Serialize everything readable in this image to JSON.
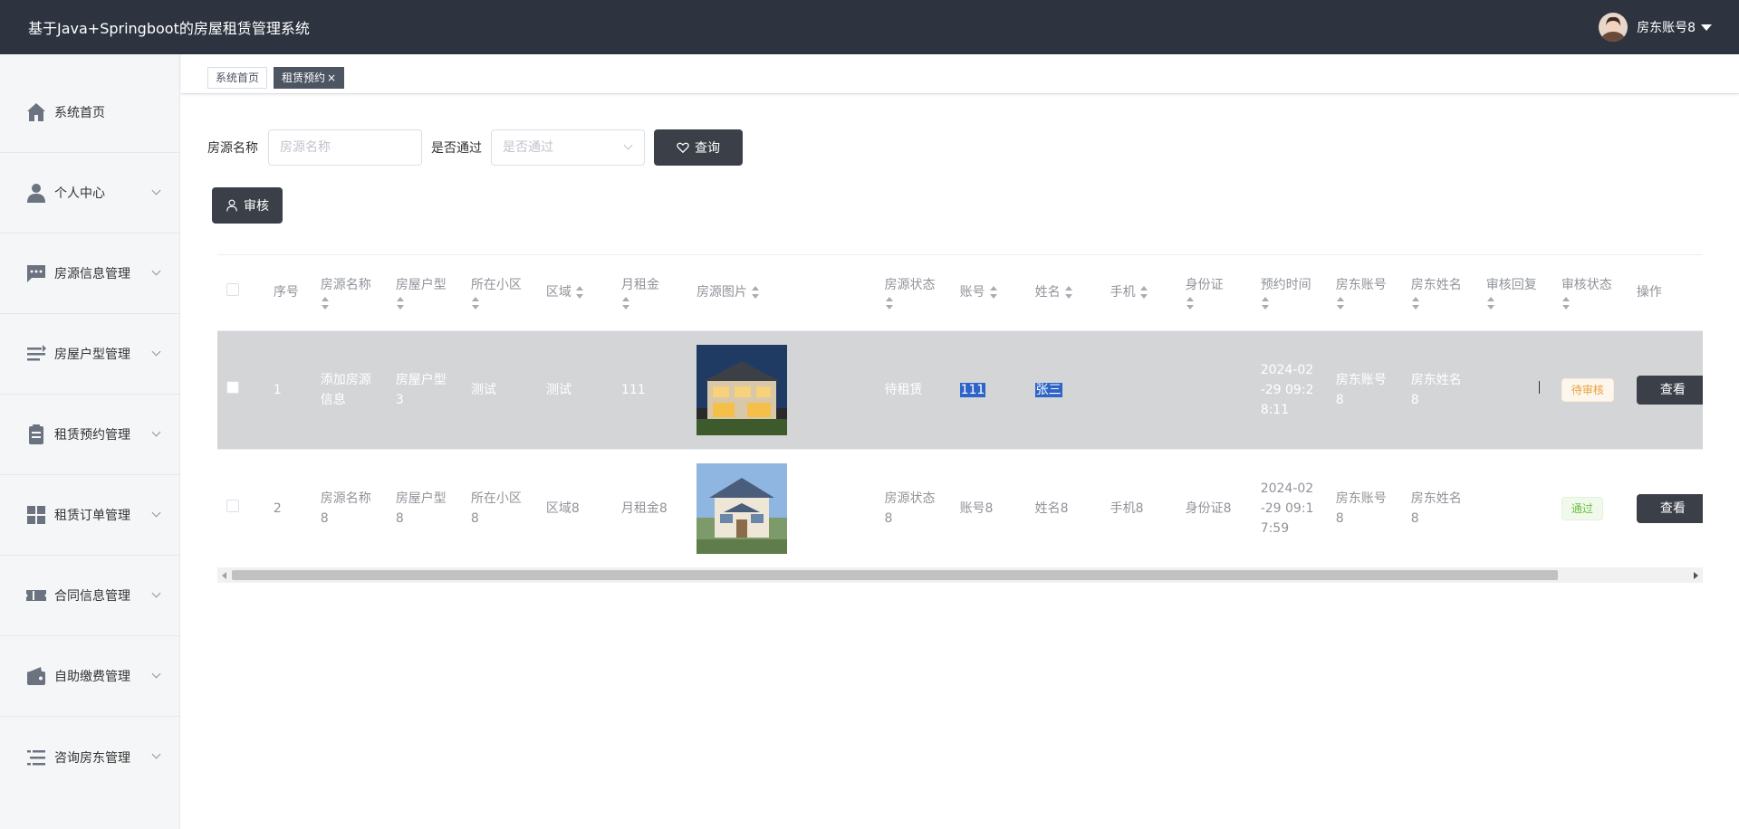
{
  "header": {
    "title": "基于Java+Springboot的房屋租赁管理系统",
    "user_name": "房东账号8"
  },
  "sidebar": {
    "items": [
      {
        "label": "系统首页",
        "icon": "home-icon"
      },
      {
        "label": "个人中心",
        "icon": "user-icon"
      },
      {
        "label": "房源信息管理",
        "icon": "chat-icon"
      },
      {
        "label": "房屋户型管理",
        "icon": "list-icon"
      },
      {
        "label": "租赁预约管理",
        "icon": "clipboard-icon"
      },
      {
        "label": "租赁订单管理",
        "icon": "grid-icon"
      },
      {
        "label": "合同信息管理",
        "icon": "ticket-icon"
      },
      {
        "label": "自助缴费管理",
        "icon": "wallet-icon"
      },
      {
        "label": "咨询房东管理",
        "icon": "menu-icon"
      }
    ]
  },
  "tabs": [
    {
      "label": "系统首页"
    },
    {
      "label": "租赁预约",
      "close": "×"
    }
  ],
  "search": {
    "name_label": "房源名称",
    "name_placeholder": "房源名称",
    "pass_label": "是否通过",
    "pass_placeholder": "是否通过",
    "query_label": "查询",
    "audit_label": "审核"
  },
  "table": {
    "headers": [
      "序号",
      "房源名称",
      "房屋户型",
      "所在小区",
      "区域",
      "月租金",
      "房源图片",
      "房源状态",
      "账号",
      "姓名",
      "手机",
      "身份证",
      "预约时间",
      "房东账号",
      "房东姓名",
      "审核回复",
      "审核状态",
      "操作"
    ],
    "rows": [
      {
        "index": "1",
        "name": "添加房源信息",
        "layout": "房屋户型3",
        "community": "测试",
        "area": "测试",
        "rent": "111",
        "status": "待租赁",
        "account": "111",
        "person": "张三",
        "phone": "",
        "idcard": "",
        "time": "2024-02-29 09:28:11",
        "owner_account": "房东账号8",
        "owner_name": "房东姓名8",
        "reply": "",
        "audit": "待审核",
        "action": "查看"
      },
      {
        "index": "2",
        "name": "房源名称8",
        "layout": "房屋户型8",
        "community": "所在小区8",
        "area": "区域8",
        "rent": "月租金8",
        "status": "房源状态8",
        "account": "账号8",
        "person": "姓名8",
        "phone": "手机8",
        "idcard": "身份证8",
        "time": "2024-02-29 09:17:59",
        "owner_account": "房东账号8",
        "owner_name": "房东姓名8",
        "reply": "",
        "audit": "通过",
        "action": "查看"
      }
    ]
  },
  "colors": {
    "header_bg": "#2d3440",
    "button_dark": "#3a3f48",
    "selected_row": "#d4d5d7"
  }
}
